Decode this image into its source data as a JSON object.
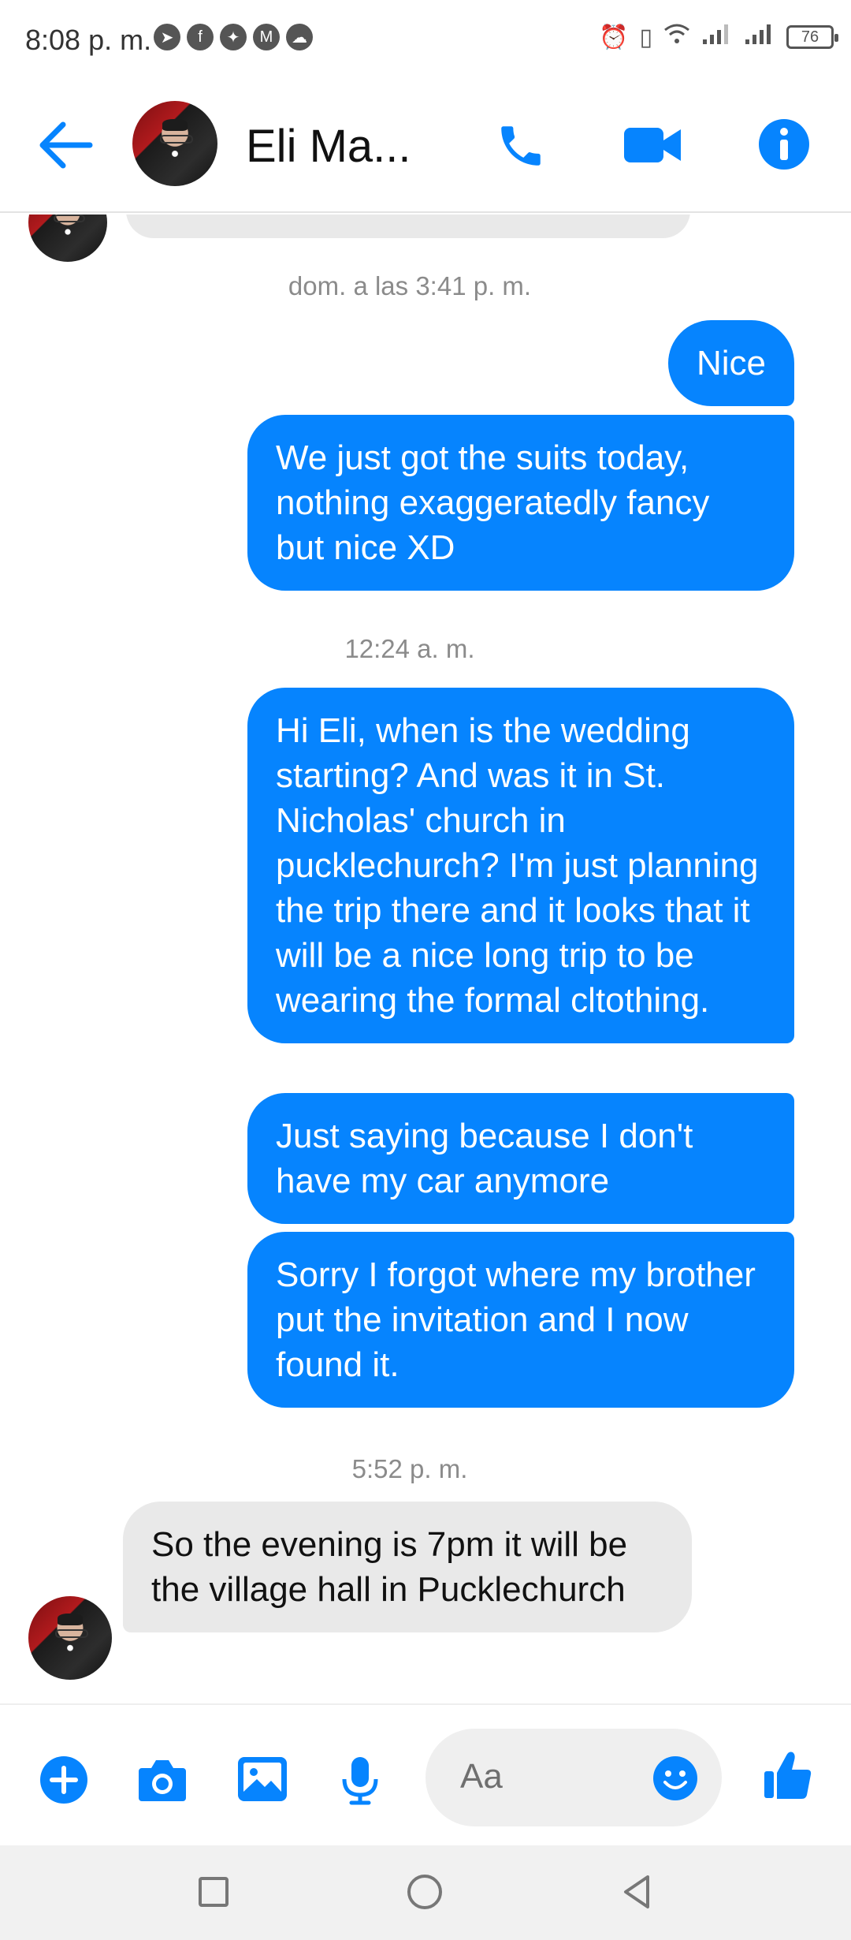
{
  "status_bar": {
    "time": "8:08 p. m.",
    "battery": "76"
  },
  "contact": {
    "name": "Eli Ma..."
  },
  "colors": {
    "accent": "#0684fe",
    "incoming_bubble": "#e9e9e9"
  },
  "messages": [
    {
      "type": "timestamp",
      "text": "dom. a las 3:41 p. m."
    },
    {
      "type": "outgoing",
      "text": "Nice"
    },
    {
      "type": "outgoing",
      "text": "We just got the suits today, nothing exaggeratedly fancy but nice XD"
    },
    {
      "type": "timestamp",
      "text": "12:24 a. m."
    },
    {
      "type": "outgoing",
      "text": "Hi Eli, when is the wedding starting? And was it in St. Nicholas' church in pucklechurch? I'm just planning the trip there and it looks that it will be a nice long trip to be wearing the formal cltothing."
    },
    {
      "type": "outgoing",
      "text": "Just saying because I don't have my car anymore"
    },
    {
      "type": "outgoing",
      "text": "Sorry I forgot where my brother put the invitation and I now found it."
    },
    {
      "type": "timestamp",
      "text": "5:52 p. m."
    },
    {
      "type": "incoming",
      "text": "So the evening is 7pm it will be the village hall in Pucklechurch"
    }
  ],
  "composer": {
    "placeholder": "Aa",
    "icons": [
      "plus-icon",
      "camera-icon",
      "gallery-icon",
      "microphone-icon",
      "emoji-icon",
      "thumbs-up-icon"
    ]
  },
  "nav_bar": {
    "icons": [
      "recents-icon",
      "home-icon",
      "back-icon"
    ]
  }
}
